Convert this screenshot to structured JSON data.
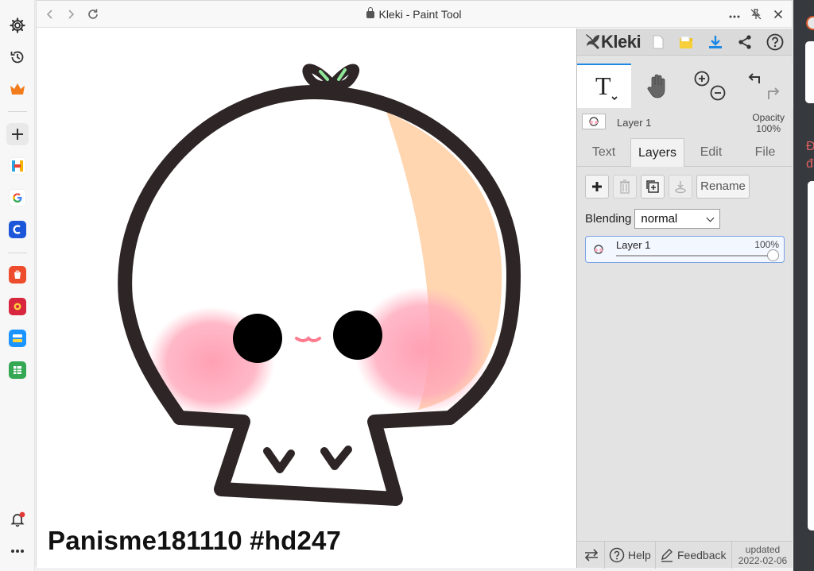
{
  "window": {
    "title": "Kleki - Paint Tool"
  },
  "canvas": {
    "watermark": "Panisme181110 #hd247"
  },
  "panel": {
    "brand": "Kleki",
    "layer_strip": {
      "name": "Layer 1",
      "opacity_label": "Opacity",
      "opacity_value": "100%"
    },
    "tabs": [
      {
        "label": "Text",
        "active": false
      },
      {
        "label": "Layers",
        "active": true
      },
      {
        "label": "Edit",
        "active": false
      },
      {
        "label": "File",
        "active": false
      }
    ],
    "rename_label": "Rename",
    "blending": {
      "label": "Blending",
      "value": "normal"
    },
    "layer": {
      "name": "Layer 1",
      "opacity": "100%"
    },
    "bottom": {
      "help": "Help",
      "feedback": "Feedback",
      "updated_label": "updated",
      "updated_date": "2022-02-06"
    }
  },
  "background": {
    "letters": [
      "Đ",
      "đ"
    ]
  },
  "icons": [
    "settings-icon",
    "history-icon",
    "crown-icon",
    "plus-icon",
    "bell-icon",
    "more-icon",
    "back-icon",
    "forward-icon",
    "reload-icon",
    "lock-icon",
    "pin-icon",
    "close-icon",
    "new-file-icon",
    "open-folder-icon",
    "download-icon",
    "share-icon",
    "help-icon",
    "text-tool-icon",
    "hand-tool-icon",
    "zoom-in-icon",
    "zoom-out-icon",
    "undo-icon",
    "redo-icon",
    "add-layer-icon",
    "delete-layer-icon",
    "duplicate-layer-icon",
    "merge-layer-icon",
    "swap-icon",
    "feedback-icon"
  ],
  "colors": {
    "accent": "#1e88e5",
    "panel": "#e3e3e3",
    "selected_border": "#7aa1e8"
  }
}
